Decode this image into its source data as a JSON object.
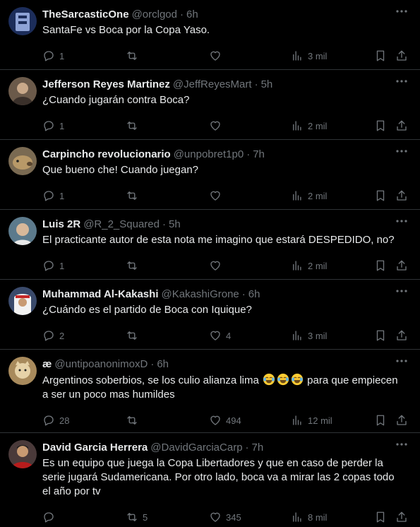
{
  "tweets": [
    {
      "name": "TheSarcasticOne",
      "handle": "@orclgod",
      "time": "6h",
      "text": "SantaFe vs Boca  por la Copa Yaso.",
      "replies": "1",
      "retweets": "",
      "likes": "",
      "views": "3 mil",
      "avatar": {
        "bg": "#1c2d5a",
        "fg": "#8ea3d6"
      }
    },
    {
      "name": "Jefferson Reyes Martinez",
      "handle": "@JeffReyesMart",
      "time": "5h",
      "text": "¿Cuando jugarán contra Boca?",
      "replies": "1",
      "retweets": "",
      "likes": "",
      "views": "2 mil",
      "avatar": {
        "bg": "#6b5a4a",
        "fg": "#c9a98a"
      }
    },
    {
      "name": "Carpincho revolucionario",
      "handle": "@unpobret1p0",
      "time": "7h",
      "text": "Que bueno che! Cuando juegan?",
      "replies": "1",
      "retweets": "",
      "likes": "",
      "views": "2 mil",
      "avatar": {
        "bg": "#7a6a52",
        "fg": "#b89968"
      }
    },
    {
      "name": "Luis 2R",
      "handle": "@R_2_Squared",
      "time": "5h",
      "text": "El practicante autor de esta nota me imagino que estará DESPEDIDO, no?",
      "replies": "1",
      "retweets": "",
      "likes": "",
      "views": "2 mil",
      "avatar": {
        "bg": "#5c7a8c",
        "fg": "#d8b89a"
      }
    },
    {
      "name": "Muhammad Al-Kakashi",
      "handle": "@KakashiGrone",
      "time": "6h",
      "text": "¿Cuándo es el partido de Boca con Iquique?",
      "replies": "2",
      "retweets": "",
      "likes": "4",
      "views": "3 mil",
      "avatar": {
        "bg": "#3a4a6b",
        "fg": "#c62828"
      }
    },
    {
      "name": "æ",
      "handle": "@untipoanonimoxD",
      "time": "6h",
      "text_before": "Argentinos soberbios, se los culio alianza lima ",
      "text_after": " para que empiecen a ser un poco mas humildes",
      "emojis": [
        "joy-emoji",
        "joy-emoji",
        "joy-emoji"
      ],
      "replies": "28",
      "retweets": "",
      "likes": "494",
      "views": "12 mil",
      "avatar": {
        "bg": "#a88a5c",
        "fg": "#e6d2a8"
      }
    },
    {
      "name": "David Garcia Herrera",
      "handle": "@DavidGarciaCarp",
      "time": "7h",
      "text": "Es un equipo que juega la Copa Libertadores y que en caso de perder la serie jugará Sudamericana. Por otro lado, boca va a mirar las 2 copas todo el año por tv",
      "replies": "",
      "retweets": "5",
      "likes": "345",
      "views": "8 mil",
      "avatar": {
        "bg": "#4a3a3a",
        "fg": "#b71c1c"
      }
    }
  ],
  "separator": "·",
  "icons": {
    "reply": "reply-icon",
    "retweet": "retweet-icon",
    "like": "heart-icon",
    "views": "views-icon",
    "bookmark": "bookmark-icon",
    "share": "share-icon",
    "more": "more-icon"
  },
  "colors": {
    "background": "#000000",
    "text": "#e7e9ea",
    "secondary": "#71767b",
    "border": "#2f3336"
  }
}
